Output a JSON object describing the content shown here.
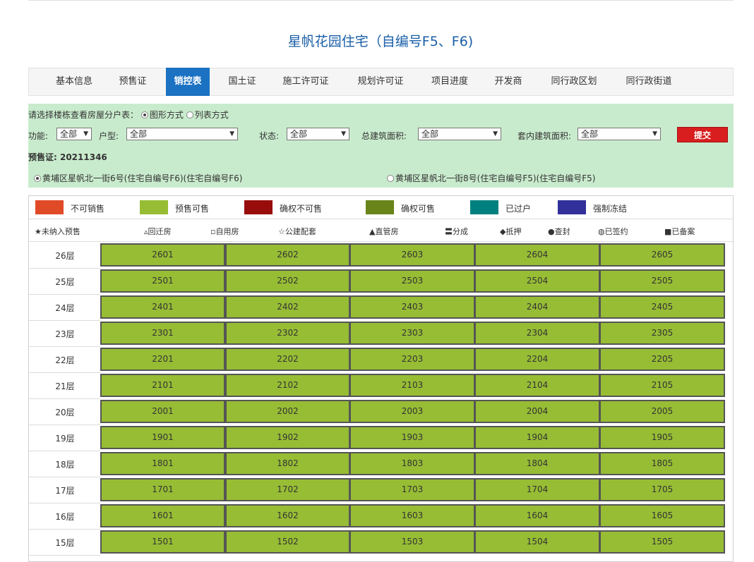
{
  "page_title": "星帆花园住宅（自编号F5、F6)",
  "tabs": [
    "基本信息",
    "预售证",
    "销控表",
    "国土证",
    "施工许可证",
    "规划许可证",
    "项目进度",
    "开发商",
    "同行政区划",
    "同行政街道"
  ],
  "active_tab": "销控表",
  "filter": {
    "view_prompt": "请选择楼栋查看房屋分户表：",
    "view_options": [
      "图形方式",
      "列表方式"
    ],
    "selected_view": "图形方式",
    "function_label": "功能:",
    "function_value": "全部",
    "type_label": "户型:",
    "type_value": "全部",
    "status_label": "状态:",
    "status_value": "全部",
    "total_area_label": "总建筑面积:",
    "total_area_value": "全部",
    "inner_area_label": "套内建筑面积:",
    "inner_area_value": "全部",
    "submit_label": "提交",
    "presale_cert": "预售证: 20211346",
    "buildings": [
      "黄埔区星帆北一街6号(住宅自编号F6)(住宅自编号F6)",
      "黄埔区星帆北一街8号(住宅自编号F5)(住宅自编号F5)"
    ],
    "selected_building": 0
  },
  "legend": [
    {
      "label": "不可销售",
      "color": "#e04a27"
    },
    {
      "label": "预售可售",
      "color": "#97bd35"
    },
    {
      "label": "确权不可售",
      "color": "#980c0c"
    },
    {
      "label": "确权可售",
      "color": "#698419"
    },
    {
      "label": "已过户",
      "color": "#00807f"
    },
    {
      "label": "强制冻结",
      "color": "#32309a"
    }
  ],
  "symbols": [
    "★未纳入预售",
    "▵回迁房",
    "▫自用房",
    "☆公建配套",
    "▲直管房",
    "〓分成",
    "◆抵押",
    "●查封",
    "◍已签约",
    "■已备案"
  ],
  "unit_color": "#97bd35",
  "floors": [
    {
      "label": "26层",
      "units": [
        "2601",
        "2602",
        "2603",
        "2604",
        "2605"
      ]
    },
    {
      "label": "25层",
      "units": [
        "2501",
        "2502",
        "2503",
        "2504",
        "2505"
      ]
    },
    {
      "label": "24层",
      "units": [
        "2401",
        "2402",
        "2403",
        "2404",
        "2405"
      ]
    },
    {
      "label": "23层",
      "units": [
        "2301",
        "2302",
        "2303",
        "2304",
        "2305"
      ]
    },
    {
      "label": "22层",
      "units": [
        "2201",
        "2202",
        "2203",
        "2204",
        "2205"
      ]
    },
    {
      "label": "21层",
      "units": [
        "2101",
        "2102",
        "2103",
        "2104",
        "2105"
      ]
    },
    {
      "label": "20层",
      "units": [
        "2001",
        "2002",
        "2003",
        "2004",
        "2005"
      ]
    },
    {
      "label": "19层",
      "units": [
        "1901",
        "1902",
        "1903",
        "1904",
        "1905"
      ]
    },
    {
      "label": "18层",
      "units": [
        "1801",
        "1802",
        "1803",
        "1804",
        "1805"
      ]
    },
    {
      "label": "17层",
      "units": [
        "1701",
        "1702",
        "1703",
        "1704",
        "1705"
      ]
    },
    {
      "label": "16层",
      "units": [
        "1601",
        "1602",
        "1603",
        "1604",
        "1605"
      ]
    },
    {
      "label": "15层",
      "units": [
        "1501",
        "1502",
        "1503",
        "1504",
        "1505"
      ]
    }
  ]
}
